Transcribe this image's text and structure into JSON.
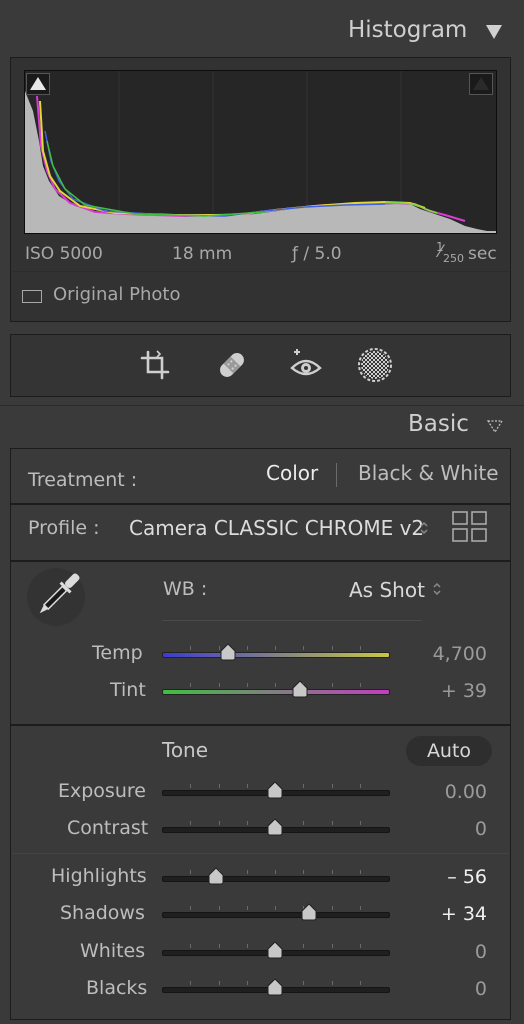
{
  "histogram": {
    "title": "Histogram",
    "meta": {
      "iso": "ISO 5000",
      "focal": "18 mm",
      "aperture": "ƒ / 5.0",
      "shutter_num": "1",
      "shutter_den": "250",
      "shutter_unit": "sec"
    },
    "original_photo_label": "Original Photo"
  },
  "tools": [
    "crop-icon",
    "healing-bandage-icon",
    "red-eye-icon",
    "masking-icon"
  ],
  "basic": {
    "title": "Basic",
    "treatment_label": "Treatment :",
    "treatment_color": "Color",
    "treatment_bw": "Black & White",
    "profile_label": "Profile :",
    "profile_value": "Camera CLASSIC CHROME v2",
    "wb_label": "WB :",
    "wb_value": "As Shot",
    "temp_label": "Temp",
    "temp_value": "4,700",
    "tint_label": "Tint",
    "tint_value": "+ 39",
    "tone_label": "Tone",
    "auto_label": "Auto",
    "exposure_label": "Exposure",
    "exposure_value": "0.00",
    "contrast_label": "Contrast",
    "contrast_value": "0",
    "highlights_label": "Highlights",
    "highlights_value": "– 56",
    "shadows_label": "Shadows",
    "shadows_value": "+ 34",
    "whites_label": "Whites",
    "whites_value": "0",
    "blacks_label": "Blacks",
    "blacks_value": "0"
  },
  "slider_levels": {
    "temp": 0.29,
    "tint": 0.61,
    "exposure": 0.5,
    "contrast": 0.5,
    "highlights": 0.24,
    "shadows": 0.65,
    "whites": 0.5,
    "blacks": 0.5
  },
  "colors": {
    "panel_bg": "#3a3a3a",
    "temp_gradient_start": "#3b3bd0",
    "temp_gradient_end": "#c8c840",
    "tint_gradient_start": "#3fbf3f",
    "tint_gradient_end": "#c43cc4"
  }
}
